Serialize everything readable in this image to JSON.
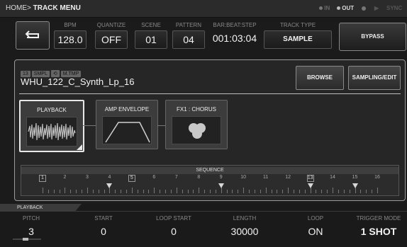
{
  "header": {
    "breadcrumb_home": "HOME",
    "breadcrumb_sep": ">",
    "breadcrumb_page": "TRACK MENU",
    "in_label": "IN",
    "out_label": "OUT",
    "sync_label": "SYNC"
  },
  "toolbar": {
    "bpm_label": "BPM",
    "bpm_value": "128.0",
    "quantize_label": "QUANTIZE",
    "quantize_value": "OFF",
    "scene_label": "SCENE",
    "scene_value": "01",
    "pattern_label": "PATTERN",
    "pattern_value": "04",
    "bbs_label": "BAR:BEAT:STEP",
    "bbs_value": "001:03:04",
    "tracktype_label": "TRACK TYPE",
    "tracktype_value": "SAMPLE",
    "bypass_label": "BYPASS"
  },
  "sample": {
    "tags": [
      "13",
      "SMPL",
      "⟲",
      "M.TMP"
    ],
    "name": "WHU_122_C_Synth_Lp_16",
    "browse_label": "BROWSE",
    "sampling_label": "SAMPLING/EDIT"
  },
  "blocks": {
    "playback": "PLAYBACK",
    "amp": "AMP ENVELOPE",
    "fx": "FX1 : CHORUS"
  },
  "sequence": {
    "title": "SEQUENCE",
    "steps": [
      "1",
      "2",
      "3",
      "4",
      "5",
      "6",
      "7",
      "8",
      "9",
      "10",
      "11",
      "12",
      "13",
      "14",
      "15",
      "16"
    ],
    "boxed_steps": [
      1,
      5,
      13
    ],
    "marked_steps": [
      4,
      9,
      13,
      15
    ]
  },
  "bottom": {
    "tab_label": "PLAYBACK",
    "params": [
      {
        "label": "PITCH",
        "value": "3"
      },
      {
        "label": "START",
        "value": "0"
      },
      {
        "label": "LOOP START",
        "value": "0"
      },
      {
        "label": "LENGTH",
        "value": "30000"
      },
      {
        "label": "LOOP",
        "value": "ON"
      },
      {
        "label": "TRIGGER MODE",
        "value": "1 SHOT"
      }
    ]
  }
}
